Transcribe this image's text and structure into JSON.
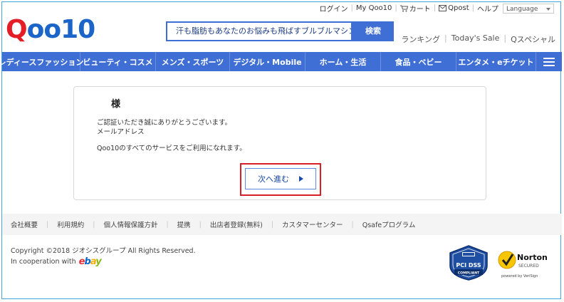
{
  "util": {
    "login": "ログイン",
    "my_qoo10": "My Qoo10",
    "cart": "カート",
    "qpost": "Qpost",
    "help": "ヘルプ",
    "language": "Language"
  },
  "logo": {
    "q": "Q",
    "rest": "oo10"
  },
  "search": {
    "query": "汗も脂肪もあなたのお悩みも飛ばすブルブルマシン",
    "button": "検索"
  },
  "quick_links": [
    "ランキング",
    "Today's Sale",
    "Qスペシャル"
  ],
  "nav": {
    "items": [
      "レディースファッション",
      "ビューティ・コスメ",
      "メンズ・スポーツ",
      "デジタル・Mobile",
      "ホーム・生活",
      "食品・ベビー",
      "エンタメ・eチケット"
    ]
  },
  "panel": {
    "name": "様",
    "line1": "ご認証いただき誠にありがとうございます。",
    "line2": "メールアドレス",
    "line3": "Qoo10のすべてのサービスをご利用になれます。",
    "next_button": "次へ進む"
  },
  "footer": {
    "links": [
      "会社概要",
      "利用規約",
      "個人情報保護方針",
      "提携",
      "出店者登録(無料)",
      "カスタマーセンター",
      "Qsafeプログラム"
    ],
    "copyright": "Copyright ©2018 ジオシスグループ All Rights Reserved.",
    "cooperation": "In cooperation with",
    "ebay": {
      "e": "e",
      "b": "b",
      "a": "a",
      "y": "y"
    },
    "pci_label": "PCI DSS",
    "pci_sub": "COMPLIANT",
    "norton_title": "Norton",
    "norton_sub": "SECURED",
    "norton_by": "powered by VeriSign"
  },
  "colors": {
    "brand_blue": "#3f6fd4",
    "brand_red": "#e41e26",
    "highlight_red": "#d81f26"
  }
}
